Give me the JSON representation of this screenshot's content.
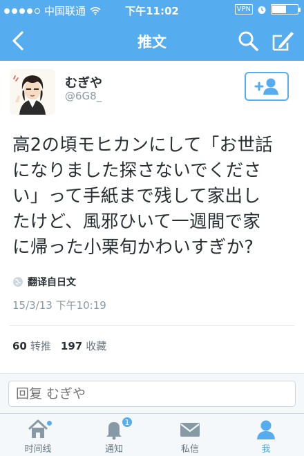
{
  "status_bar": {
    "carrier": "中国联通",
    "time": "下午11:02",
    "vpn": "VPN",
    "battery_level": 0.55
  },
  "nav": {
    "title": "推文",
    "icons": [
      "back-chevron-icon",
      "search-icon",
      "compose-icon"
    ]
  },
  "user": {
    "display_name": "むぎや",
    "handle": "@6G8_",
    "follow_icon": "add-user-icon"
  },
  "tweet": {
    "lines": [
      "高2の頃モヒカンにして「お世話",
      "になりました探さないでくださ",
      "い」って手紙まで残して家出し",
      "たけど、風邪ひいて一週間で家",
      "に帰った小栗旬かわいすぎか?"
    ],
    "translate_label": "翻译自日文",
    "timestamp": "15/3/13 下午10:19"
  },
  "stats": {
    "retweets_count": "60",
    "retweets_label": "转推",
    "favorites_count": "197",
    "favorites_label": "收藏"
  },
  "reply": {
    "placeholder": "回复 むぎや"
  },
  "tabs": [
    {
      "label": "时间线",
      "icon": "home-icon"
    },
    {
      "label": "通知",
      "icon": "notifications-icon",
      "badge": "1"
    },
    {
      "label": "私信",
      "icon": "messages-icon"
    },
    {
      "label": "我",
      "icon": "profile-icon"
    }
  ],
  "colors": {
    "brand": "#55acee",
    "text": "#292f33",
    "muted": "#8899a6"
  }
}
